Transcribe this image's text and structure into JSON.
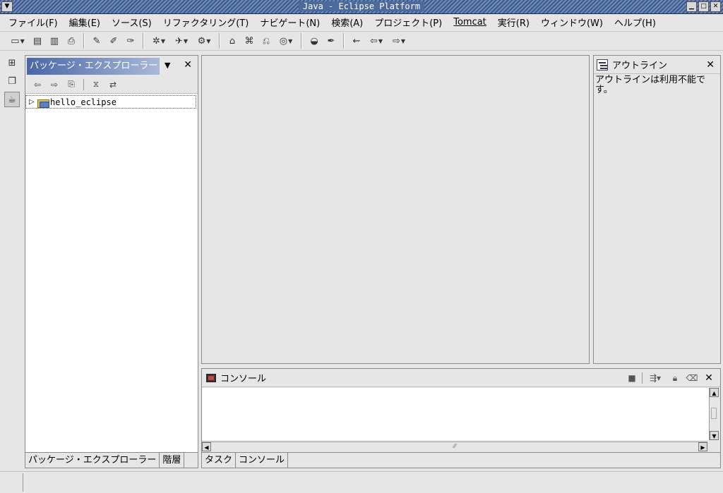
{
  "window": {
    "title": "Java - Eclipse Platform",
    "system_menu_icon": "chevron-down-icon",
    "buttons": [
      "minimize",
      "maximize",
      "close"
    ]
  },
  "menubar": {
    "items": [
      {
        "label": "ファイル(F)"
      },
      {
        "label": "編集(E)"
      },
      {
        "label": "ソース(S)"
      },
      {
        "label": "リファクタリング(T)"
      },
      {
        "label": "ナビゲート(N)"
      },
      {
        "label": "検索(A)"
      },
      {
        "label": "プロジェクト(P)"
      },
      {
        "label": "Tomcat"
      },
      {
        "label": "実行(R)"
      },
      {
        "label": "ウィンドウ(W)"
      },
      {
        "label": "ヘルプ(H)"
      }
    ]
  },
  "toolbar": {
    "icons": [
      "new-wizard-icon",
      "save-icon",
      "save-all-icon",
      "print-icon",
      "new-java-project-icon",
      "new-package-icon",
      "new-class-icon",
      "debug-icon",
      "run-icon",
      "external-tools-icon",
      "tomcat-start-icon",
      "tomcat-stop-icon",
      "tomcat-restart-icon",
      "open-type-icon",
      "search-icon",
      "open-editor-icon",
      "last-edit-location-icon",
      "back-icon",
      "forward-icon"
    ]
  },
  "perspectives": {
    "icons": [
      "open-perspective-icon",
      "resource-perspective-icon",
      "java-perspective-icon"
    ]
  },
  "package_explorer": {
    "title": "パッケージ・エクスプローラー",
    "tree": [
      {
        "label": "hello_eclipse",
        "expanded": false
      }
    ],
    "bottom_tabs": [
      {
        "label": "パッケージ・エクスプローラー",
        "selected": true
      },
      {
        "label": "階層",
        "selected": false
      }
    ]
  },
  "outline": {
    "title": "アウトライン",
    "message": "アウトラインは利用不能です。"
  },
  "console": {
    "title": "コンソール",
    "bottom_tabs": [
      {
        "label": "タスク",
        "selected": false
      },
      {
        "label": "コンソール",
        "selected": true
      }
    ]
  }
}
